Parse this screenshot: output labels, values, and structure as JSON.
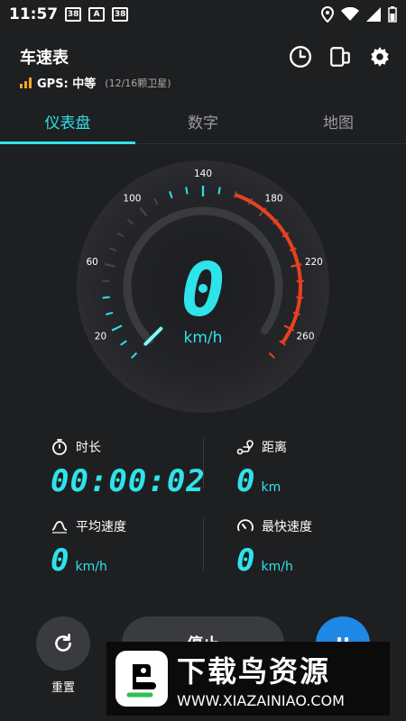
{
  "status_bar": {
    "time": "11:57",
    "notif_icons": [
      "38",
      "A",
      "38"
    ]
  },
  "header": {
    "title": "车速表",
    "gps_label": "GPS: 中等",
    "gps_satellites": "(12/16颗卫星)",
    "icons": [
      "history-icon",
      "screen-rotate-icon",
      "gear-icon"
    ]
  },
  "tabs": [
    {
      "label": "仪表盘",
      "active": true
    },
    {
      "label": "数字",
      "active": false
    },
    {
      "label": "地图",
      "active": false
    }
  ],
  "gauge": {
    "speed": "0",
    "unit": "km/h",
    "tick_labels": [
      "20",
      "60",
      "100",
      "140",
      "180",
      "220",
      "260"
    ],
    "max": 280,
    "accent": "#2fe3ea",
    "redline_color": "#e8411f"
  },
  "stats": {
    "duration": {
      "label": "时长",
      "value": "00:00:02"
    },
    "distance": {
      "label": "距离",
      "value": "0",
      "unit": "km"
    },
    "avg_speed": {
      "label": "平均速度",
      "value": "0",
      "unit": "km/h"
    },
    "max_speed": {
      "label": "最快速度",
      "value": "0",
      "unit": "km/h"
    }
  },
  "controls": {
    "reset_label": "重置",
    "main_label": "停止"
  },
  "watermark": {
    "brand": "下载鸟资源",
    "url": "WWW.XIAZAINIAO.COM"
  }
}
